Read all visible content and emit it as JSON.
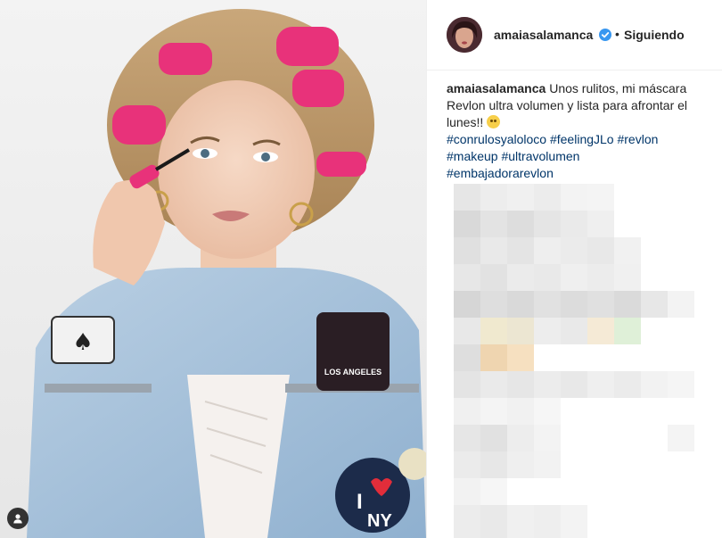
{
  "post": {
    "image_alt": "Woman with pink hair rollers applying mascara, wearing a patched denim jacket",
    "patch_text_1": "LOS ANGELES",
    "patch_text_2": "I",
    "patch_text_3": "NY"
  },
  "header": {
    "username": "amaiasalamanca",
    "separator": "•",
    "follow_status": "Siguiendo"
  },
  "caption": {
    "username": "amaiasalamanca",
    "text": "Unos rulitos, mi máscara Revlon ultra volumen y lista para afrontar el lunes!!",
    "hashtags": [
      "#conrulosyaloloco",
      "#feelingJLo",
      "#revlon",
      "#makeup",
      "#ultravolumen",
      "#embajadorarevlon"
    ]
  },
  "colors": {
    "hashtag": "#003569",
    "text": "#262626",
    "verified": "#3897f0",
    "rollers": "#e8327a"
  },
  "icons": {
    "tag": "person-tag-icon",
    "verified": "verified-badge-icon",
    "emoji": "grimacing-face-emoji"
  }
}
